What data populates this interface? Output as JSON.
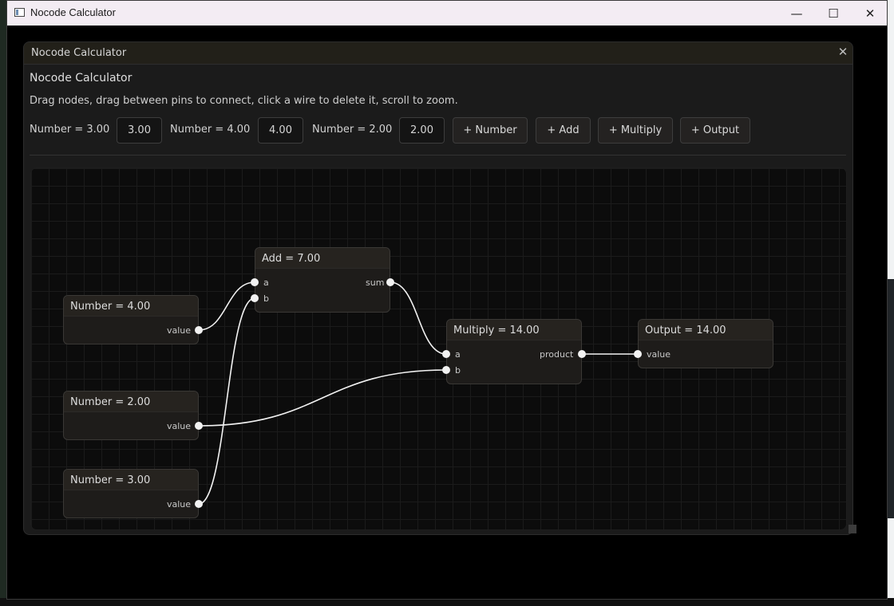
{
  "window": {
    "title": "Nocode Calculator",
    "minimize_glyph": "—",
    "maximize_glyph": "☐",
    "close_glyph": "✕"
  },
  "panel": {
    "title": "Nocode Calculator",
    "close_glyph": "✕"
  },
  "app": {
    "title": "Nocode Calculator",
    "help": "Drag nodes, drag between pins to connect, click a wire to delete it, scroll to zoom."
  },
  "toolbar": {
    "number_controls": [
      {
        "label": "Number = 3.00",
        "value": "3.00"
      },
      {
        "label": "Number = 4.00",
        "value": "4.00"
      },
      {
        "label": "Number = 2.00",
        "value": "2.00"
      }
    ],
    "buttons": [
      "+ Number",
      "+ Add",
      "+ Multiply",
      "+ Output"
    ]
  },
  "graph": {
    "nodes": {
      "number_4": {
        "title": "Number = 4.00",
        "out": "value"
      },
      "number_2": {
        "title": "Number = 2.00",
        "out": "value"
      },
      "number_3": {
        "title": "Number = 3.00",
        "out": "value"
      },
      "add": {
        "title": "Add = 7.00",
        "in_a": "a",
        "in_b": "b",
        "out": "sum"
      },
      "multiply": {
        "title": "Multiply = 14.00",
        "in_a": "a",
        "in_b": "b",
        "out": "product"
      },
      "output": {
        "title": "Output = 14.00",
        "in": "value"
      }
    },
    "wire_color": "#f2f2f2"
  }
}
